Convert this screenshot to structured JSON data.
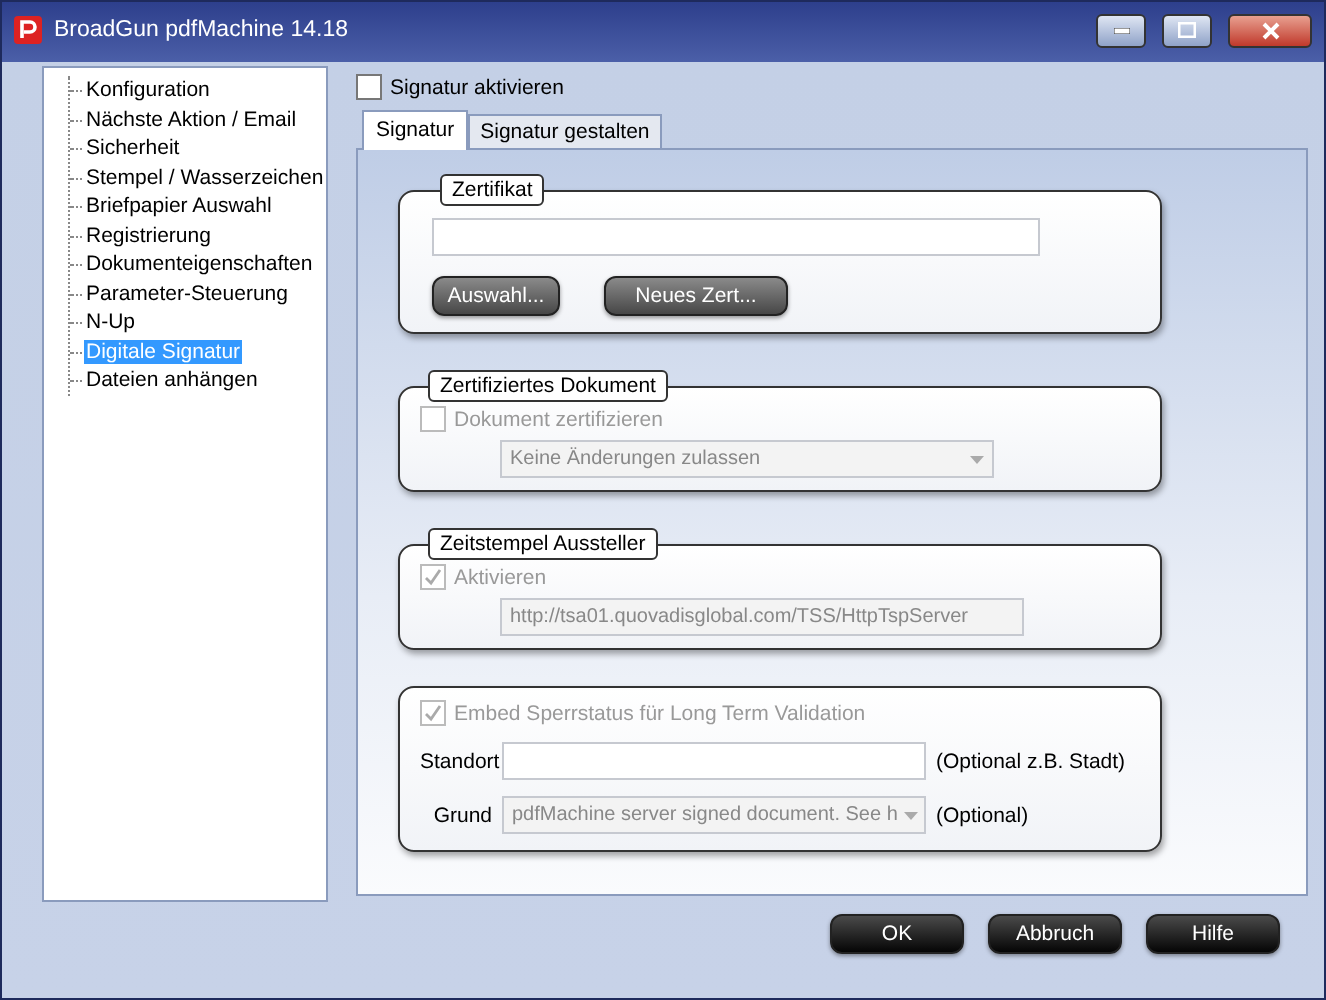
{
  "window": {
    "title": "BroadGun pdfMachine 14.18"
  },
  "sidebar": {
    "items": [
      {
        "label": "Konfiguration",
        "selected": false
      },
      {
        "label": "Nächste Aktion / Email",
        "selected": false
      },
      {
        "label": "Sicherheit",
        "selected": false
      },
      {
        "label": "Stempel / Wasserzeichen",
        "selected": false
      },
      {
        "label": "Briefpapier Auswahl",
        "selected": false
      },
      {
        "label": "Registrierung",
        "selected": false
      },
      {
        "label": "Dokumenteigenschaften",
        "selected": false
      },
      {
        "label": "Parameter-Steuerung",
        "selected": false
      },
      {
        "label": "N-Up",
        "selected": false
      },
      {
        "label": "Digitale Signatur",
        "selected": true
      },
      {
        "label": "Dateien anhängen",
        "selected": false
      }
    ]
  },
  "signature_enable": {
    "label": "Signatur aktivieren",
    "checked": false
  },
  "tabs": [
    {
      "label": "Signatur",
      "selected": true
    },
    {
      "label": "Signatur gestalten",
      "selected": false
    }
  ],
  "certificate": {
    "title": "Zertifikat",
    "buttons": [
      "Auswahl...",
      "Neues Zert..."
    ]
  },
  "certified_document": {
    "title": "Zertifiziertes Dokument",
    "checkbox": {
      "label": "Dokument zertifizieren",
      "checked": false,
      "disabled": true
    },
    "dropdown": {
      "value": "Keine Änderungen zulassen",
      "disabled": true
    }
  },
  "timestamp": {
    "title": "Zeitstempel Aussteller",
    "checkbox": {
      "label": "Aktivieren",
      "checked": true,
      "disabled": true
    },
    "server": {
      "value": "http://tsa01.quovadisglobal.com/TSS/HttpTspServer",
      "disabled": true
    }
  },
  "validation": {
    "checkbox": {
      "label": "Embed Sperrstatus für Long Term Validation",
      "checked": true,
      "disabled": true
    },
    "location": {
      "label": "Standort",
      "hint": "(Optional z.B. Stadt)"
    },
    "reason": {
      "label": "Grund",
      "value": "pdfMachine server signed document. See h",
      "disabled": true,
      "hint": "(Optional)"
    }
  },
  "buttons": [
    "OK",
    "Abbruch",
    "Hilfe"
  ]
}
